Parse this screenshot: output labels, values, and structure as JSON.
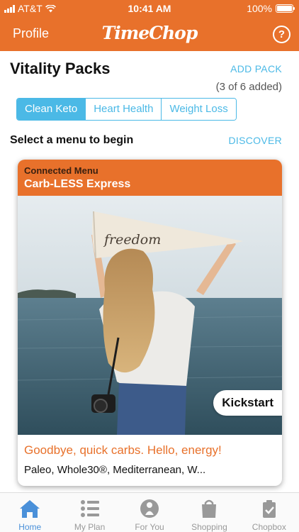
{
  "status_bar": {
    "carrier": "AT&T",
    "time": "10:41 AM",
    "battery_text": "100%",
    "battery_level": 1.0
  },
  "nav": {
    "left_label": "Profile",
    "logo": "TimeChop",
    "help_icon": "question-circle-icon"
  },
  "colors": {
    "brand_orange": "#e8712b",
    "accent_blue": "#4bb9e6",
    "tab_active_blue": "#4a90d9"
  },
  "packs": {
    "title": "Vitality Packs",
    "add_label": "ADD PACK",
    "count_text": "(3 of 6 added)",
    "tabs": [
      {
        "label": "Clean Keto",
        "active": true
      },
      {
        "label": "Heart Health",
        "active": false
      },
      {
        "label": "Weight Loss",
        "active": false
      }
    ]
  },
  "menu_section": {
    "prompt": "Select a menu to begin",
    "discover_label": "DISCOVER"
  },
  "menu_card": {
    "subtitle": "Connected Menu",
    "title": "Carb-LESS Express",
    "image_flag_text": "freedom",
    "badge": "Kickstart",
    "tagline": "Goodbye, quick carbs. Hello, energy!",
    "diets": "Paleo, Whole30®, Mediterranean, W..."
  },
  "tabbar": [
    {
      "label": "Home",
      "icon": "home-icon",
      "active": true
    },
    {
      "label": "My Plan",
      "icon": "list-icon",
      "active": false
    },
    {
      "label": "For You",
      "icon": "person-icon",
      "active": false
    },
    {
      "label": "Shopping",
      "icon": "shopping-bag-icon",
      "active": false
    },
    {
      "label": "Chopbox",
      "icon": "chopbox-icon",
      "active": false
    }
  ]
}
